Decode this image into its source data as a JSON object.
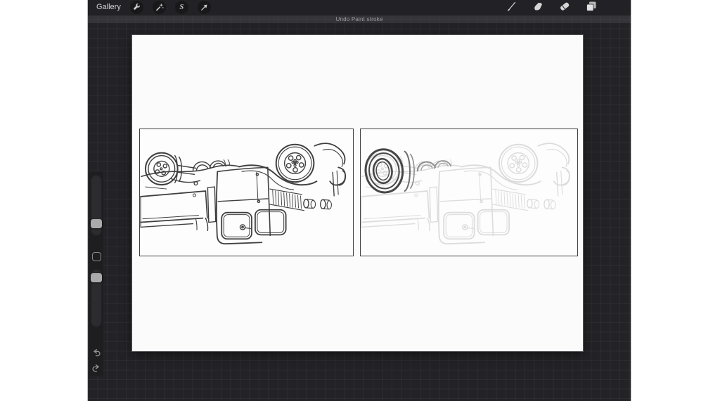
{
  "toolbar": {
    "gallery_label": "Gallery",
    "selection_glyph": "S",
    "left_tools": [
      {
        "id": "actions",
        "icon": "wrench-icon"
      },
      {
        "id": "adjustments",
        "icon": "magic-wand-icon"
      },
      {
        "id": "selection",
        "icon": "selection-s-icon"
      },
      {
        "id": "transform",
        "icon": "transform-arrow-icon"
      }
    ],
    "right_tools": [
      {
        "id": "paint",
        "icon": "paintbrush-icon"
      },
      {
        "id": "smudge",
        "icon": "smudge-finger-icon"
      },
      {
        "id": "erase",
        "icon": "eraser-icon"
      },
      {
        "id": "layers",
        "icon": "layers-icon"
      }
    ],
    "color_swatch_color": "#0b0b10"
  },
  "toast": {
    "message": "Undo Paint stroke"
  },
  "sidebar": {
    "size_slider_value_pct": 22,
    "opacity_slider_value_pct": 93,
    "modify_button": true,
    "undo_icon": "undo-arrow-icon",
    "redo_icon": "redo-arrow-icon"
  },
  "canvas": {
    "background": "#fbfbfb",
    "panels": [
      {
        "id": "panel-1",
        "description": "Dark ink line sketch of an upside-down vintage pickup truck, wheels up",
        "stroke": "#3f3f3f"
      },
      {
        "id": "panel-2",
        "description": "Faint pencil version of the same upside-down truck with the left wheel re-inked dark",
        "stroke": "#dcdcdc",
        "accent_stroke": "#474747"
      }
    ]
  }
}
